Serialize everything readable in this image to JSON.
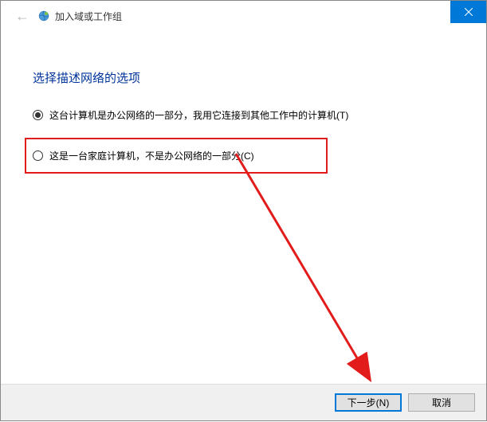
{
  "window": {
    "title": "加入域或工作组"
  },
  "heading": "选择描述网络的选项",
  "options": {
    "office": "这台计算机是办公网络的一部分，我用它连接到其他工作中的计算机(T)",
    "home": "这是一台家庭计算机，不是办公网络的一部分(C)"
  },
  "buttons": {
    "next": "下一步(N)",
    "cancel": "取消"
  },
  "selected": "office"
}
